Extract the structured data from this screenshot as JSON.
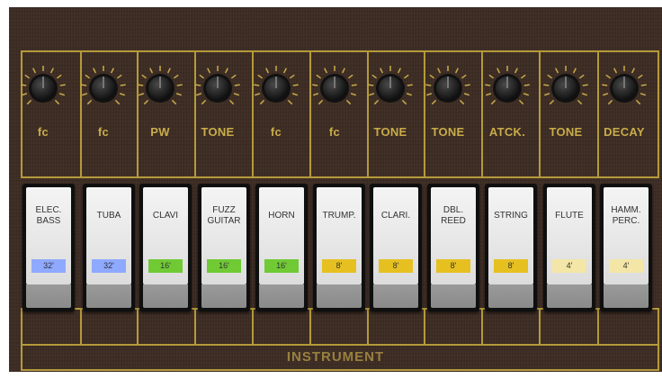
{
  "knobs": [
    {
      "label": "fc"
    },
    {
      "label": "fc"
    },
    {
      "label": "PW"
    },
    {
      "label": "TONE"
    },
    {
      "label": "fc"
    },
    {
      "label": "fc"
    },
    {
      "label": "TONE"
    },
    {
      "label": "TONE"
    },
    {
      "label": "ATCK."
    },
    {
      "label": "TONE"
    },
    {
      "label": "DECAY"
    }
  ],
  "instruments": [
    {
      "label": "ELEC.\nBASS",
      "footage": "32'",
      "color": "#8ea9ff"
    },
    {
      "label": "TUBA",
      "footage": "32'",
      "color": "#8ea9ff"
    },
    {
      "label": "CLAVI",
      "footage": "16'",
      "color": "#6fca34"
    },
    {
      "label": "FUZZ\nGUITAR",
      "footage": "16'",
      "color": "#6fca34"
    },
    {
      "label": "HORN",
      "footage": "16'",
      "color": "#6fca34"
    },
    {
      "label": "TRUMP.",
      "footage": "8'",
      "color": "#e6c020"
    },
    {
      "label": "CLARI.",
      "footage": "8'",
      "color": "#e6c020"
    },
    {
      "label": "DBL.\nREED",
      "footage": "8'",
      "color": "#e6c020"
    },
    {
      "label": "STRING",
      "footage": "8'",
      "color": "#e6c020"
    },
    {
      "label": "FLUTE",
      "footage": "4'",
      "color": "#f3e6a6"
    },
    {
      "label": "HAMM.\nPERC.",
      "footage": "4'",
      "color": "#f3e6a6"
    }
  ],
  "section": {
    "label": "INSTRUMENT"
  },
  "colors": {
    "panel": "#3b2a21",
    "frame": "#b59a3a",
    "text": "#c9ac4a"
  }
}
